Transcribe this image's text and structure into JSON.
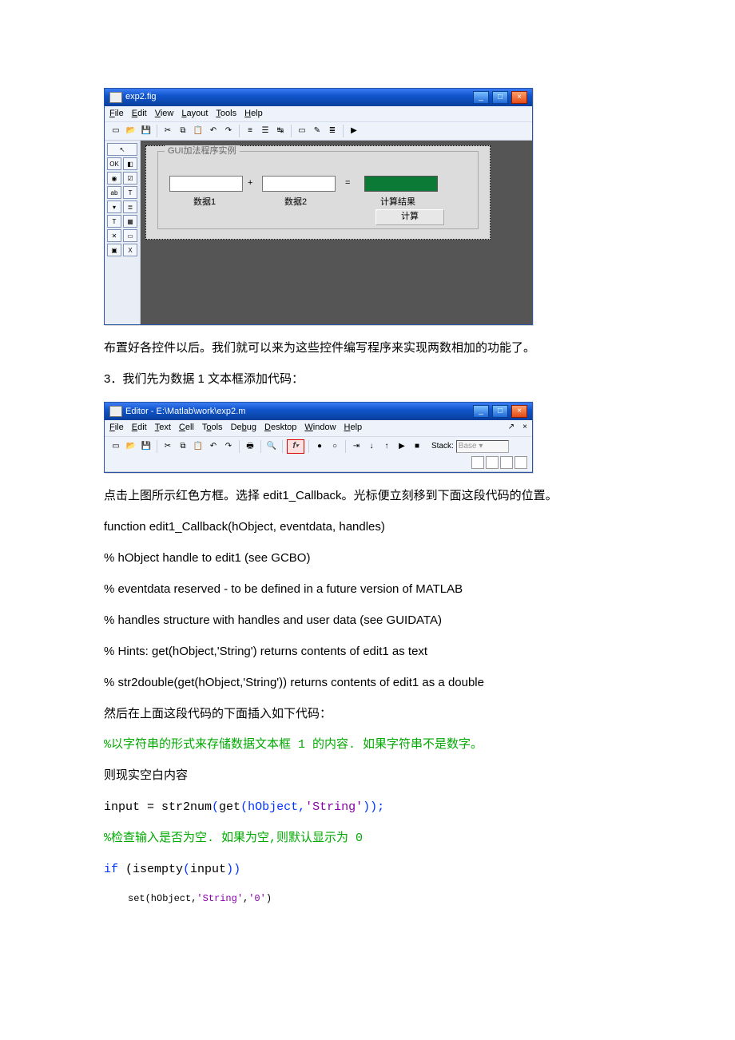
{
  "guide": {
    "title": "exp2.fig",
    "menu": [
      "File",
      "Edit",
      "View",
      "Layout",
      "Tools",
      "Help"
    ],
    "panel_legend": "GUI加法程序实例",
    "plus": "+",
    "equals": "=",
    "label_data1": "数据1",
    "label_data2": "数据2",
    "label_result": "计算结果",
    "btn_calc": "计算"
  },
  "para1": "布置好各控件以后。我们就可以来为这些控件编写程序来实现两数相加的功能了。",
  "para2": "3．我们先为数据 1 文本框添加代码：",
  "editor": {
    "title": "Editor - E:\\Matlab\\work\\exp2.m",
    "menu": [
      "File",
      "Edit",
      "Text",
      "Cell",
      "Tools",
      "Debug",
      "Desktop",
      "Window",
      "Help"
    ],
    "stack_label": "Stack:",
    "stack_value": "Base"
  },
  "para3": "点击上图所示红色方框。选择 edit1_Callback。光标便立刻移到下面这段代码的位置。",
  "code_fn": "function edit1_Callback(hObject, eventdata, handles)",
  "code_c1": "% hObject handle to edit1 (see GCBO)",
  "code_c2": "% eventdata reserved - to be defined in a future version of MATLAB",
  "code_c3": "% handles structure with handles and user data (see GUIDATA)",
  "code_c4": "% Hints: get(hObject,'String') returns contents of edit1 as text",
  "code_c5": "% str2double(get(hObject,'String')) returns contents of edit1 as a double",
  "para4": "然后在上面这段代码的下面插入如下代码：",
  "g1": "%以字符串的形式来存储数据文本框 1 的内容. 如果字符串不是数字。",
  "g2": "则现实空白内容",
  "codeA": {
    "p1": "input = str2num",
    "p2": "(",
    "p3": "get",
    "p4": "(hObject,",
    "p5": "'String'",
    "p6": "));"
  },
  "g3": "%检查输入是否为空. 如果为空,则默认显示为 0",
  "codeB": {
    "p1": "if",
    "p2": " (isempty",
    "p3": "(",
    "p4": "input",
    "p5": "))"
  },
  "codeC": {
    "p1": "set(hObject,",
    "p2": "'String'",
    "p3": ",",
    "p4": "'0'",
    "p5": ")"
  }
}
